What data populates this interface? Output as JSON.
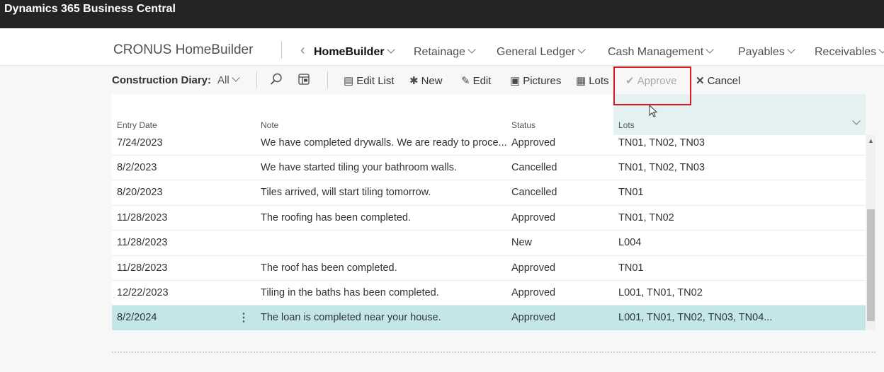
{
  "app": {
    "title": "Dynamics 365 Business Central"
  },
  "nav": {
    "company": "CRONUS HomeBuilder",
    "items": [
      {
        "label": "HomeBuilder",
        "active": true
      },
      {
        "label": "Retainage"
      },
      {
        "label": "General Ledger"
      },
      {
        "label": "Cash Management"
      },
      {
        "label": "Payables"
      },
      {
        "label": "Receivables"
      }
    ]
  },
  "toolbar": {
    "page_label": "Construction Diary:",
    "filter_value": "All",
    "edit_list": "Edit List",
    "new": "New",
    "edit": "Edit",
    "pictures": "Pictures",
    "lots": "Lots",
    "approve": "Approve",
    "cancel": "Cancel"
  },
  "table": {
    "columns": [
      "Entry Date",
      "Note",
      "Status",
      "Lots"
    ],
    "rows": [
      {
        "date": "7/24/2023",
        "note": "We have completed drywalls. We are ready to proce...",
        "status": "Approved",
        "lots": "TN01, TN02, TN03"
      },
      {
        "date": "8/2/2023",
        "note": "We have started tiling your bathroom walls.",
        "status": "Cancelled",
        "lots": "TN01, TN02, TN03"
      },
      {
        "date": "8/20/2023",
        "note": "Tiles arrived, will start tiling tomorrow.",
        "status": "Cancelled",
        "lots": "TN01"
      },
      {
        "date": "11/28/2023",
        "note": "The roofing has been completed.",
        "status": "Approved",
        "lots": "TN01, TN02"
      },
      {
        "date": "11/28/2023",
        "note": "",
        "status": "New",
        "lots": "L004"
      },
      {
        "date": "11/28/2023",
        "note": "The roof has been completed.",
        "status": "Approved",
        "lots": "TN01"
      },
      {
        "date": "12/22/2023",
        "note": "Tiling in the baths has been completed.",
        "status": "Approved",
        "lots": "L001, TN01, TN02"
      },
      {
        "date": "8/2/2024",
        "note": "The loan is completed near your house.",
        "status": "Approved",
        "lots": "L001, TN01, TN02, TN03, TN04...",
        "selected": true
      }
    ]
  },
  "colors": {
    "topbar": "#242424",
    "selected_row": "#c3e6e8",
    "highlight": "#d9191f"
  }
}
